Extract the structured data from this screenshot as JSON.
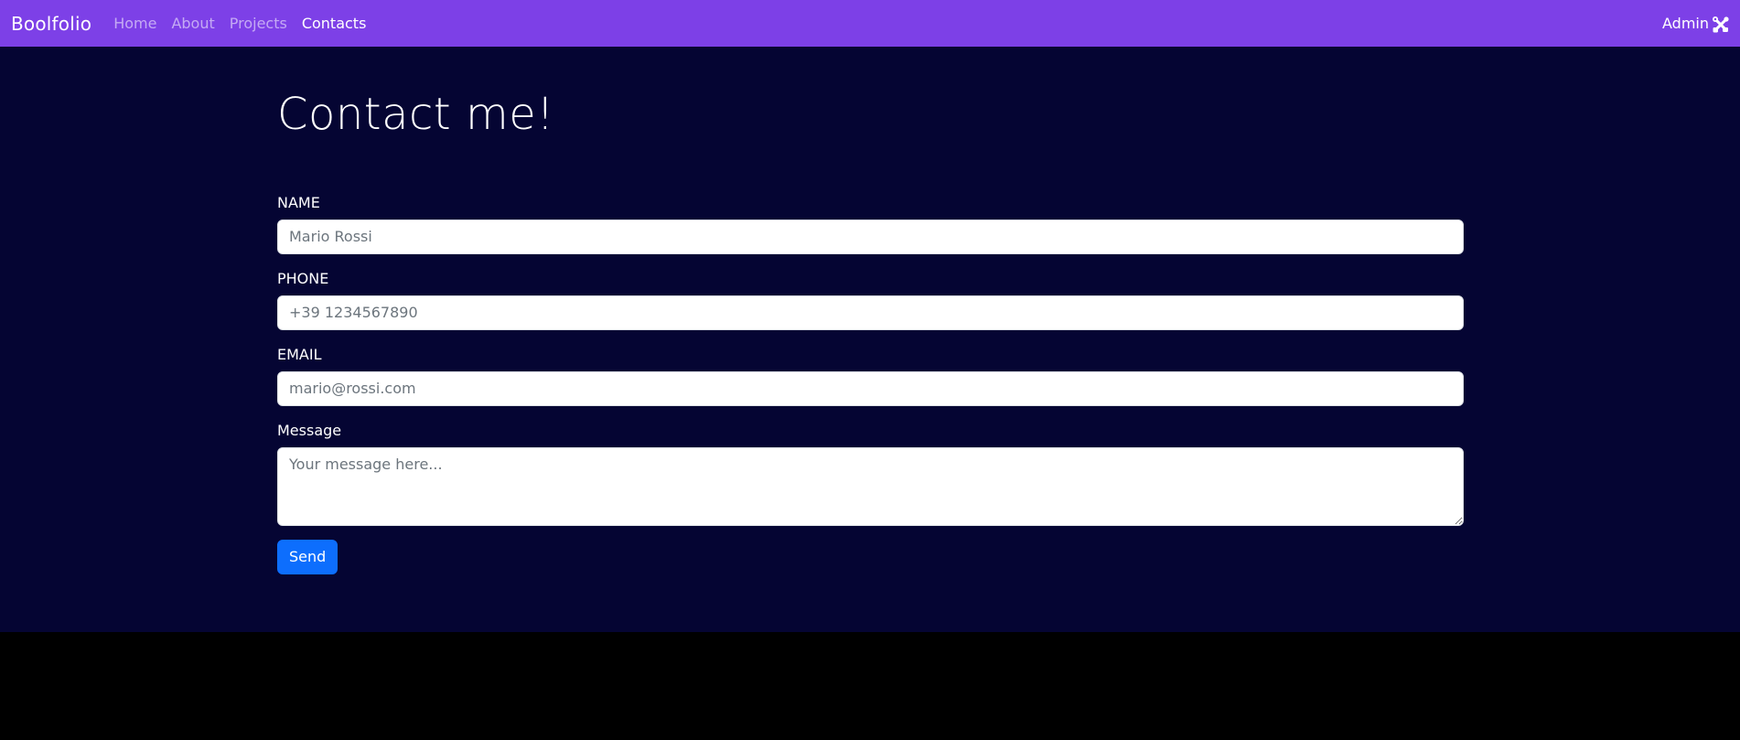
{
  "navbar": {
    "brand": "Boolfolio",
    "links": [
      {
        "label": "Home",
        "active": false
      },
      {
        "label": "About",
        "active": false
      },
      {
        "label": "Projects",
        "active": false
      },
      {
        "label": "Contacts",
        "active": true
      }
    ],
    "admin_label": "Admin",
    "admin_icon": "tools-icon"
  },
  "page": {
    "title": "Contact me!"
  },
  "form": {
    "name": {
      "label": "NAME",
      "placeholder": "Mario Rossi",
      "value": ""
    },
    "phone": {
      "label": "PHONE",
      "placeholder": "+39 1234567890",
      "value": ""
    },
    "email": {
      "label": "EMAIL",
      "placeholder": "mario@rossi.com",
      "value": ""
    },
    "message": {
      "label": "Message",
      "placeholder": "Your message here...",
      "value": ""
    },
    "submit_label": "Send"
  },
  "colors": {
    "navbar_bg": "#7d40e7",
    "main_bg": "#050533",
    "page_bg": "#000000",
    "button_bg": "#0d6efd"
  }
}
